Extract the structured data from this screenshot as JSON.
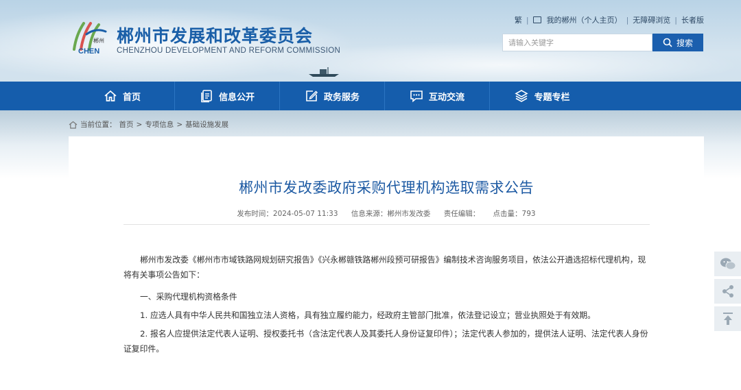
{
  "header": {
    "site_name_cn": "郴州市发展和改革委员会",
    "site_name_en": "CHENZHOU DEVELOPMENT AND REFORM COMMISSION",
    "logo_small_text": "郴州",
    "logo_word": "CHEN",
    "top_links": {
      "traditional": "繁",
      "my_chenzhou": "我的郴州（个人主页）",
      "accessible": "无障碍浏览",
      "elder": "长者版"
    },
    "search": {
      "placeholder": "请输入关键字",
      "button_label": "搜索"
    }
  },
  "nav": {
    "items": [
      {
        "label": "首页",
        "icon": "home-icon"
      },
      {
        "label": "信息公开",
        "icon": "document-icon"
      },
      {
        "label": "政务服务",
        "icon": "edit-icon"
      },
      {
        "label": "互动交流",
        "icon": "chat-icon"
      },
      {
        "label": "专题专栏",
        "icon": "layers-icon"
      }
    ]
  },
  "breadcrumb": {
    "prefix": "当前位置：",
    "items": [
      "首页",
      "专项信息",
      "基础设施发展"
    ],
    "separator": ">"
  },
  "article": {
    "title": "郴州市发改委政府采购代理机构选取需求公告",
    "meta": {
      "published": "发布时间：2024-05-07 11:33",
      "source": "信息来源：郴州市发改委",
      "editor": "责任编辑：",
      "views": "点击量：793"
    },
    "paragraphs": [
      "郴州市发改委《郴州市市域铁路网规划研究报告》《兴永郴赣铁路郴州段预可研报告》编制技术咨询服务项目，依法公开遴选招标代理机构，现将有关事项公告如下：",
      "一、采购代理机构资格条件",
      "1. 应选人具有中华人民共和国独立法人资格，具有独立履约能力，经政府主管部门批准，依法登记设立；营业执照处于有效期。",
      "2. 报名人应提供法定代表人证明、授权委托书（含法定代表人及其委托人身份证复印件）；法定代表人参加的，提供法人证明、法定代表人身份证复印件。"
    ]
  },
  "side_tools": [
    "wechat-icon",
    "share-icon",
    "back-to-top-icon"
  ],
  "colors": {
    "brand_blue": "#155dac",
    "title_blue": "#1d5aa3",
    "logo_green": "#6aa84f"
  }
}
